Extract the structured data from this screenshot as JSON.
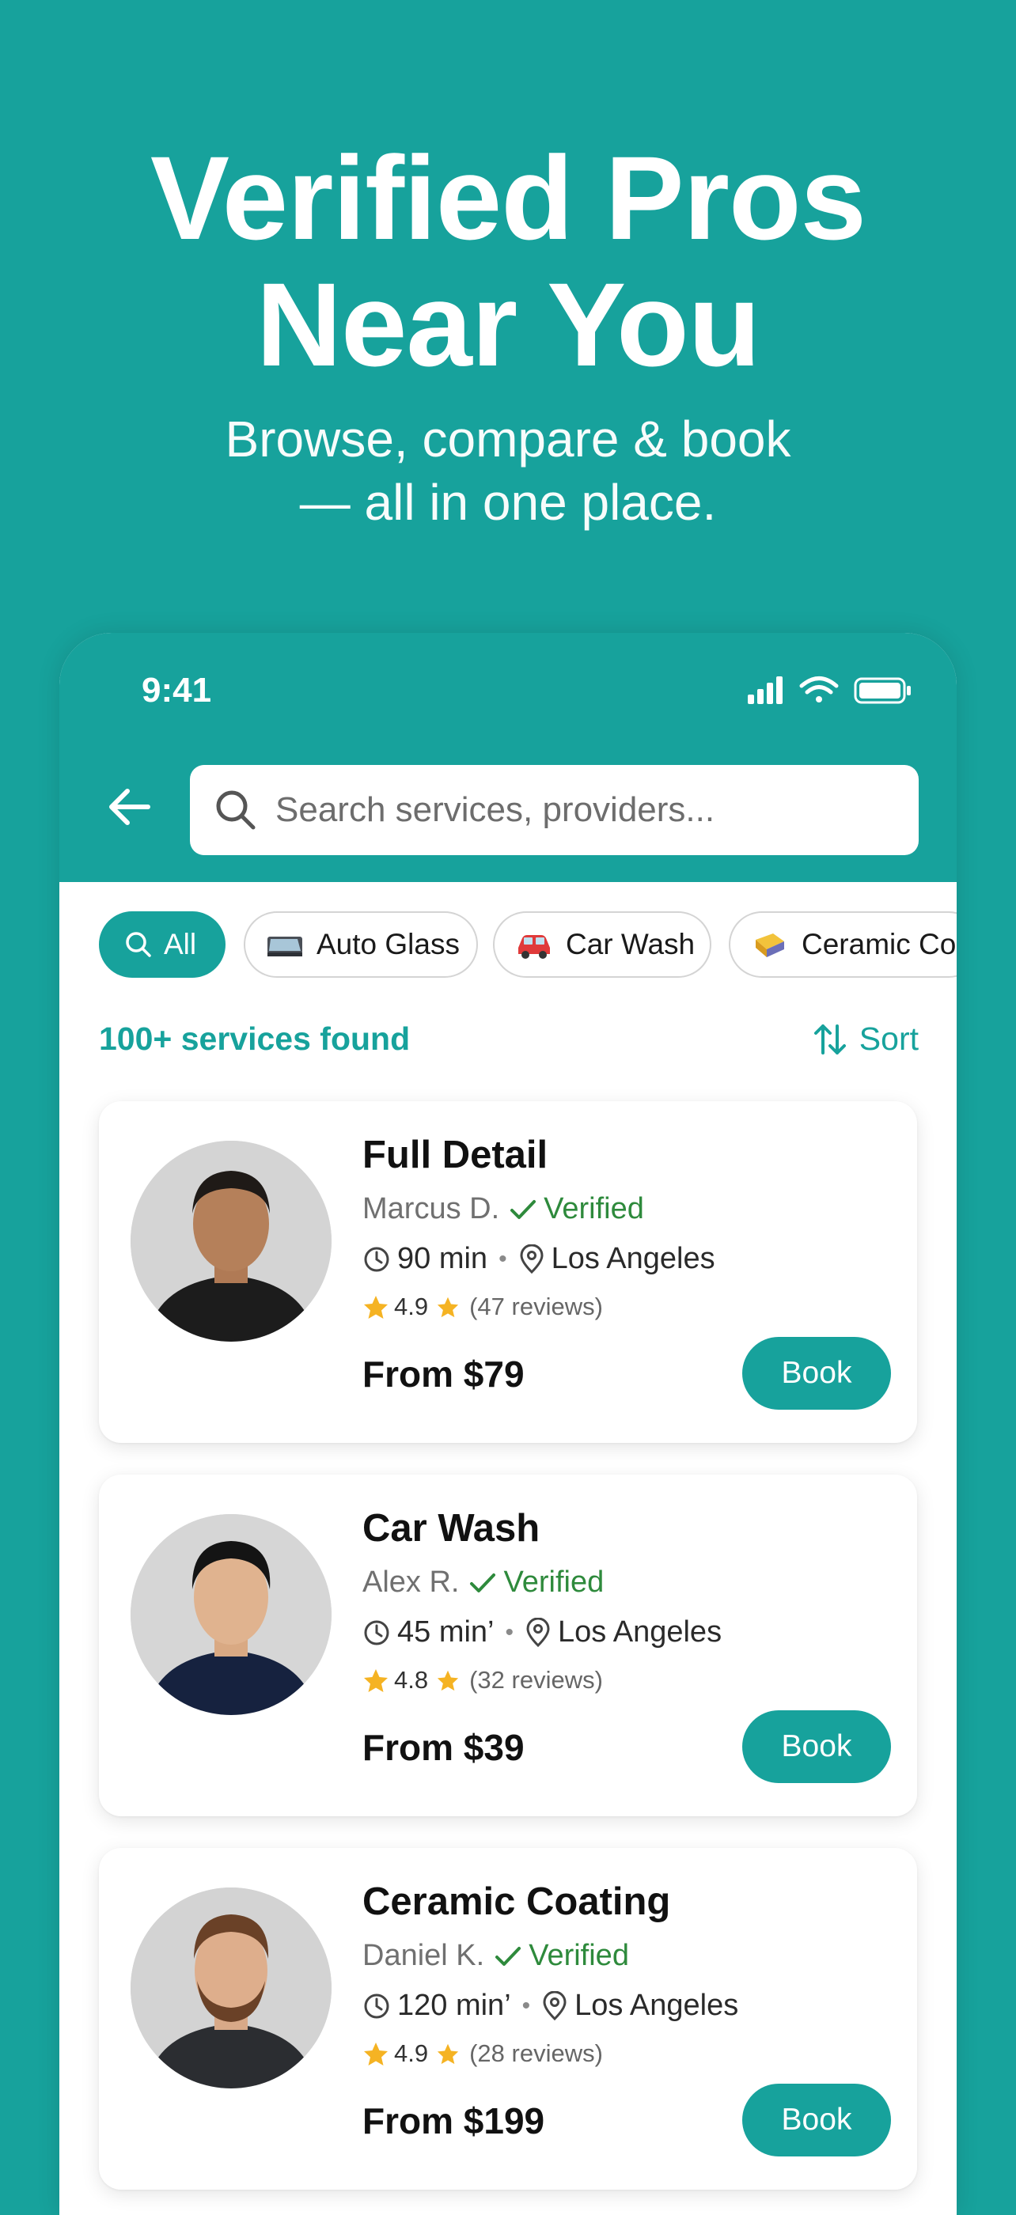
{
  "hero": {
    "title_line1": "Verified Pros",
    "title_line2": "Near You",
    "subtitle_line1": "Browse, compare & book",
    "subtitle_line2": "— all in one place."
  },
  "status_bar": {
    "time": "9:41"
  },
  "search": {
    "placeholder": "Search services, providers..."
  },
  "chips": [
    {
      "label": "All",
      "icon": "search-icon",
      "active": true
    },
    {
      "label": "Auto Glass",
      "icon": "auto-glass-icon",
      "active": false
    },
    {
      "label": "Car Wash",
      "icon": "car-icon",
      "active": false
    },
    {
      "label": "Ceramic Coa",
      "icon": "ceramic-coating-icon",
      "active": false
    }
  ],
  "results": {
    "count": "100+ services found",
    "sort_label": "Sort"
  },
  "services": [
    {
      "title": "Full Detail",
      "provider": "Marcus D.",
      "verified": "Verified",
      "duration": "90 min",
      "location": "Los Angeles",
      "rating": "4.9",
      "reviews": "(47 reviews)",
      "price": "From $79",
      "book": "Book"
    },
    {
      "title": "Car Wash",
      "provider": "Alex R.",
      "verified": "Verified",
      "duration": "45 min’",
      "location": "Los Angeles",
      "rating": "4.8",
      "reviews": "(32 reviews)",
      "price": "From $39",
      "book": "Book"
    },
    {
      "title": "Ceramic Coating",
      "provider": "Daniel K.",
      "verified": "Verified",
      "duration": "120 min’",
      "location": "Los Angeles",
      "rating": "4.9",
      "reviews": "(28 reviews)",
      "price": "From $199",
      "book": "Book"
    }
  ],
  "colors": {
    "accent": "#17a29c",
    "verified": "#2e8a3c",
    "star": "#f5b323"
  }
}
